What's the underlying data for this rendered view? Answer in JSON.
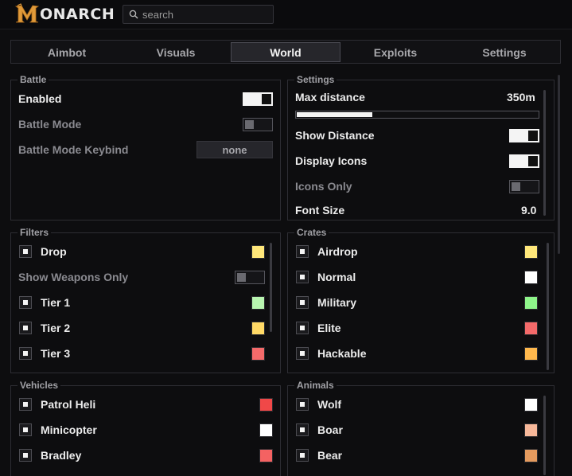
{
  "app": {
    "title": "ONARCH",
    "search_placeholder": "search"
  },
  "tabs": [
    {
      "label": "Aimbot",
      "active": false
    },
    {
      "label": "Visuals",
      "active": false
    },
    {
      "label": "World",
      "active": true
    },
    {
      "label": "Exploits",
      "active": false
    },
    {
      "label": "Settings",
      "active": false
    }
  ],
  "battle": {
    "title": "Battle",
    "enabled_label": "Enabled",
    "enabled_on": true,
    "mode_label": "Battle Mode",
    "mode_on": false,
    "keybind_label": "Battle Mode Keybind",
    "keybind_value": "none"
  },
  "settings": {
    "title": "Settings",
    "max_distance_label": "Max distance",
    "max_distance_value": "350m",
    "max_distance_fraction": 0.31,
    "show_distance_label": "Show Distance",
    "show_distance_on": true,
    "display_icons_label": "Display Icons",
    "display_icons_on": true,
    "icons_only_label": "Icons Only",
    "icons_only_on": false,
    "font_size_label": "Font Size",
    "font_size_value": "9.0"
  },
  "filters": {
    "title": "Filters",
    "drop_label": "Drop",
    "drop_color": "#ffe77a",
    "weapons_only_label": "Show Weapons Only",
    "weapons_only_on": false,
    "tier1_label": "Tier 1",
    "tier1_color": "#b8f5b0",
    "tier2_label": "Tier 2",
    "tier2_color": "#ffd966",
    "tier3_label": "Tier 3",
    "tier3_color": "#f46a6a"
  },
  "crates": {
    "title": "Crates",
    "items": [
      {
        "label": "Airdrop",
        "color": "#ffe77a"
      },
      {
        "label": "Normal",
        "color": "#ffffff"
      },
      {
        "label": "Military",
        "color": "#8ef58a"
      },
      {
        "label": "Elite",
        "color": "#f46a6a"
      },
      {
        "label": "Hackable",
        "color": "#ffb84d"
      }
    ]
  },
  "vehicles": {
    "title": "Vehicles",
    "items": [
      {
        "label": "Patrol Heli",
        "color": "#f04848"
      },
      {
        "label": "Minicopter",
        "color": "#ffffff"
      },
      {
        "label": "Bradley",
        "color": "#f46262"
      }
    ]
  },
  "animals": {
    "title": "Animals",
    "items": [
      {
        "label": "Wolf",
        "color": "#ffffff"
      },
      {
        "label": "Boar",
        "color": "#f7b89a"
      },
      {
        "label": "Bear",
        "color": "#e49a5e"
      }
    ]
  }
}
